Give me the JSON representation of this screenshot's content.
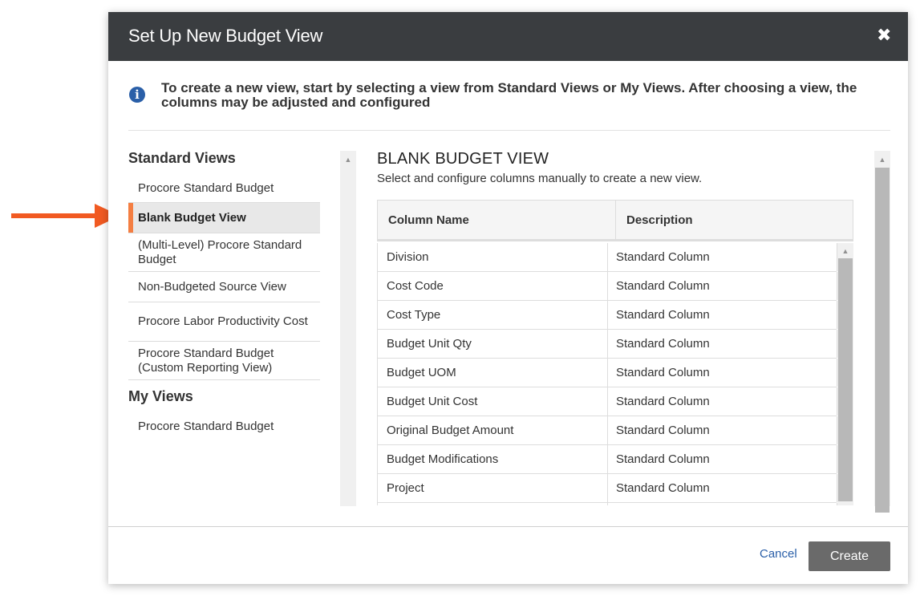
{
  "modal": {
    "title": "Set Up New Budget View",
    "close_icon": "close-icon",
    "info_icon": "info-icon",
    "info_text": "To create a new view, start by selecting a view from Standard Views or My Views. After choosing a view, the columns may be adjusted and configured"
  },
  "sidebar": {
    "standard_views_title": "Standard Views",
    "standard_views": [
      {
        "label": "Procore Standard Budget"
      },
      {
        "label": "Blank Budget View"
      },
      {
        "label": "(Multi-Level) Procore Standard Budget"
      },
      {
        "label": "Non-Budgeted Source View"
      },
      {
        "label": "Procore Labor Productivity Cost"
      },
      {
        "label": "Procore Standard Budget (Custom Reporting View)"
      }
    ],
    "selected_view": "Blank Budget View",
    "my_views_title": "My Views",
    "my_views": [
      {
        "label": "Procore Standard Budget"
      }
    ]
  },
  "main": {
    "title": "BLANK BUDGET VIEW",
    "subtitle": "Select and configure columns manually to create a new view.",
    "table": {
      "headers": [
        "Column Name",
        "Description"
      ],
      "rows": [
        [
          "Division",
          "Standard Column"
        ],
        [
          "Cost Code",
          "Standard Column"
        ],
        [
          "Cost Type",
          "Standard Column"
        ],
        [
          "Budget Unit Qty",
          "Standard Column"
        ],
        [
          "Budget UOM",
          "Standard Column"
        ],
        [
          "Budget Unit Cost",
          "Standard Column"
        ],
        [
          "Original Budget Amount",
          "Standard Column"
        ],
        [
          "Budget Modifications",
          "Standard Column"
        ],
        [
          "Project",
          "Standard Column"
        ]
      ]
    }
  },
  "footer": {
    "cancel_label": "Cancel",
    "create_label": "Create"
  },
  "colors": {
    "header_bg": "#3a3d40",
    "accent": "#f47e42",
    "link": "#2a5fa8",
    "button": "#6a6a6a"
  }
}
